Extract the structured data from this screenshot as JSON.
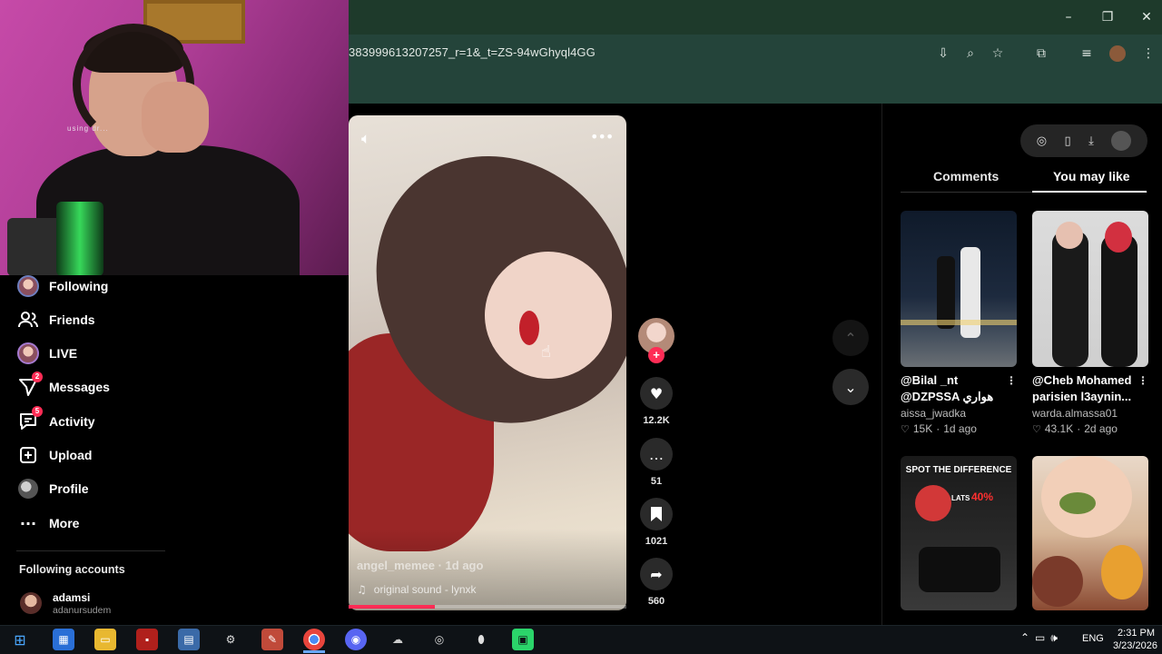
{
  "window": {
    "minimize": "–",
    "restore": "❐",
    "close": "✕"
  },
  "address_bar": {
    "url_fragment": "383999613207257_r=1&_t=ZS-94wGhyql4GG"
  },
  "webcam": {
    "caption": "using dr..."
  },
  "sidebar": {
    "items": [
      {
        "label": "Following",
        "icon": "following-avatar-icon"
      },
      {
        "label": "Friends",
        "icon": "friends-icon"
      },
      {
        "label": "LIVE",
        "icon": "live-avatar-icon"
      },
      {
        "label": "Messages",
        "icon": "messages-icon",
        "badge": "2"
      },
      {
        "label": "Activity",
        "icon": "activity-icon",
        "badge": "5"
      },
      {
        "label": "Upload",
        "icon": "upload-icon"
      },
      {
        "label": "Profile",
        "icon": "profile-avatar-icon"
      },
      {
        "label": "More",
        "icon": "more-dots-icon"
      }
    ],
    "following_accounts_title": "Following accounts",
    "accounts": [
      {
        "name": "adamsi",
        "handle": "adanursudem"
      }
    ]
  },
  "video": {
    "author": "angel_memee · 1d ago",
    "sound": "original sound - lynxk",
    "progress": 0.31
  },
  "actions": {
    "likes": "12.2K",
    "comments": "51",
    "saves": "1021",
    "shares": "560"
  },
  "right_panel": {
    "tabs": [
      {
        "label": "Comments",
        "active": false
      },
      {
        "label": "You may like",
        "active": true
      }
    ],
    "cards": [
      {
        "title": "@Bilal _nt @DZPSSA هواري SAPSDZ...",
        "author": "aissa_jwadka",
        "likes": "15K",
        "age": "1d ago"
      },
      {
        "title": "@Cheb Mohamed parisien l3aynin...",
        "author": "warda.almassa01",
        "likes": "43.1K",
        "age": "2d ago"
      },
      {
        "title": "",
        "author": "",
        "likes": "",
        "age": "",
        "overlay": "SPOT THE DIFFERENCE",
        "overlay2": "LATS",
        "overlay3": "40%"
      },
      {
        "title": "",
        "author": "",
        "likes": "",
        "age": ""
      }
    ]
  },
  "taskbar": {
    "lang": "ENG",
    "time": "2:31 PM",
    "date": "3/23/2026"
  },
  "colors": {
    "accent": "#fe2c55",
    "chrome_title": "#1e3a2b",
    "chrome_toolbar": "#24443a"
  }
}
